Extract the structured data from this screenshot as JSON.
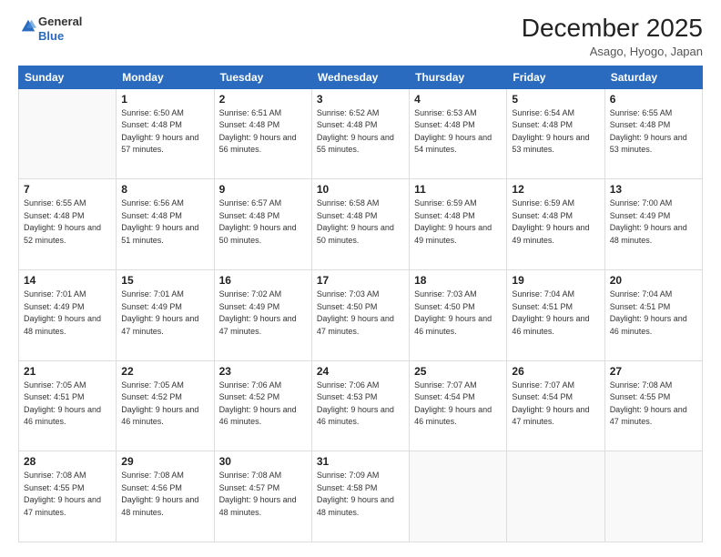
{
  "header": {
    "logo": {
      "line1": "General",
      "line2": "Blue"
    },
    "title": "December 2025",
    "location": "Asago, Hyogo, Japan"
  },
  "calendar": {
    "days_of_week": [
      "Sunday",
      "Monday",
      "Tuesday",
      "Wednesday",
      "Thursday",
      "Friday",
      "Saturday"
    ],
    "weeks": [
      [
        {
          "day": "",
          "empty": true
        },
        {
          "day": "1",
          "sunrise": "6:50 AM",
          "sunset": "4:48 PM",
          "daylight": "9 hours and 57 minutes."
        },
        {
          "day": "2",
          "sunrise": "6:51 AM",
          "sunset": "4:48 PM",
          "daylight": "9 hours and 56 minutes."
        },
        {
          "day": "3",
          "sunrise": "6:52 AM",
          "sunset": "4:48 PM",
          "daylight": "9 hours and 55 minutes."
        },
        {
          "day": "4",
          "sunrise": "6:53 AM",
          "sunset": "4:48 PM",
          "daylight": "9 hours and 54 minutes."
        },
        {
          "day": "5",
          "sunrise": "6:54 AM",
          "sunset": "4:48 PM",
          "daylight": "9 hours and 53 minutes."
        },
        {
          "day": "6",
          "sunrise": "6:55 AM",
          "sunset": "4:48 PM",
          "daylight": "9 hours and 53 minutes."
        }
      ],
      [
        {
          "day": "7",
          "sunrise": "6:55 AM",
          "sunset": "4:48 PM",
          "daylight": "9 hours and 52 minutes."
        },
        {
          "day": "8",
          "sunrise": "6:56 AM",
          "sunset": "4:48 PM",
          "daylight": "9 hours and 51 minutes."
        },
        {
          "day": "9",
          "sunrise": "6:57 AM",
          "sunset": "4:48 PM",
          "daylight": "9 hours and 50 minutes."
        },
        {
          "day": "10",
          "sunrise": "6:58 AM",
          "sunset": "4:48 PM",
          "daylight": "9 hours and 50 minutes."
        },
        {
          "day": "11",
          "sunrise": "6:59 AM",
          "sunset": "4:48 PM",
          "daylight": "9 hours and 49 minutes."
        },
        {
          "day": "12",
          "sunrise": "6:59 AM",
          "sunset": "4:48 PM",
          "daylight": "9 hours and 49 minutes."
        },
        {
          "day": "13",
          "sunrise": "7:00 AM",
          "sunset": "4:49 PM",
          "daylight": "9 hours and 48 minutes."
        }
      ],
      [
        {
          "day": "14",
          "sunrise": "7:01 AM",
          "sunset": "4:49 PM",
          "daylight": "9 hours and 48 minutes."
        },
        {
          "day": "15",
          "sunrise": "7:01 AM",
          "sunset": "4:49 PM",
          "daylight": "9 hours and 47 minutes."
        },
        {
          "day": "16",
          "sunrise": "7:02 AM",
          "sunset": "4:49 PM",
          "daylight": "9 hours and 47 minutes."
        },
        {
          "day": "17",
          "sunrise": "7:03 AM",
          "sunset": "4:50 PM",
          "daylight": "9 hours and 47 minutes."
        },
        {
          "day": "18",
          "sunrise": "7:03 AM",
          "sunset": "4:50 PM",
          "daylight": "9 hours and 46 minutes."
        },
        {
          "day": "19",
          "sunrise": "7:04 AM",
          "sunset": "4:51 PM",
          "daylight": "9 hours and 46 minutes."
        },
        {
          "day": "20",
          "sunrise": "7:04 AM",
          "sunset": "4:51 PM",
          "daylight": "9 hours and 46 minutes."
        }
      ],
      [
        {
          "day": "21",
          "sunrise": "7:05 AM",
          "sunset": "4:51 PM",
          "daylight": "9 hours and 46 minutes."
        },
        {
          "day": "22",
          "sunrise": "7:05 AM",
          "sunset": "4:52 PM",
          "daylight": "9 hours and 46 minutes."
        },
        {
          "day": "23",
          "sunrise": "7:06 AM",
          "sunset": "4:52 PM",
          "daylight": "9 hours and 46 minutes."
        },
        {
          "day": "24",
          "sunrise": "7:06 AM",
          "sunset": "4:53 PM",
          "daylight": "9 hours and 46 minutes."
        },
        {
          "day": "25",
          "sunrise": "7:07 AM",
          "sunset": "4:54 PM",
          "daylight": "9 hours and 46 minutes."
        },
        {
          "day": "26",
          "sunrise": "7:07 AM",
          "sunset": "4:54 PM",
          "daylight": "9 hours and 47 minutes."
        },
        {
          "day": "27",
          "sunrise": "7:08 AM",
          "sunset": "4:55 PM",
          "daylight": "9 hours and 47 minutes."
        }
      ],
      [
        {
          "day": "28",
          "sunrise": "7:08 AM",
          "sunset": "4:55 PM",
          "daylight": "9 hours and 47 minutes."
        },
        {
          "day": "29",
          "sunrise": "7:08 AM",
          "sunset": "4:56 PM",
          "daylight": "9 hours and 48 minutes."
        },
        {
          "day": "30",
          "sunrise": "7:08 AM",
          "sunset": "4:57 PM",
          "daylight": "9 hours and 48 minutes."
        },
        {
          "day": "31",
          "sunrise": "7:09 AM",
          "sunset": "4:58 PM",
          "daylight": "9 hours and 48 minutes."
        },
        {
          "day": "",
          "empty": true
        },
        {
          "day": "",
          "empty": true
        },
        {
          "day": "",
          "empty": true
        }
      ]
    ]
  }
}
